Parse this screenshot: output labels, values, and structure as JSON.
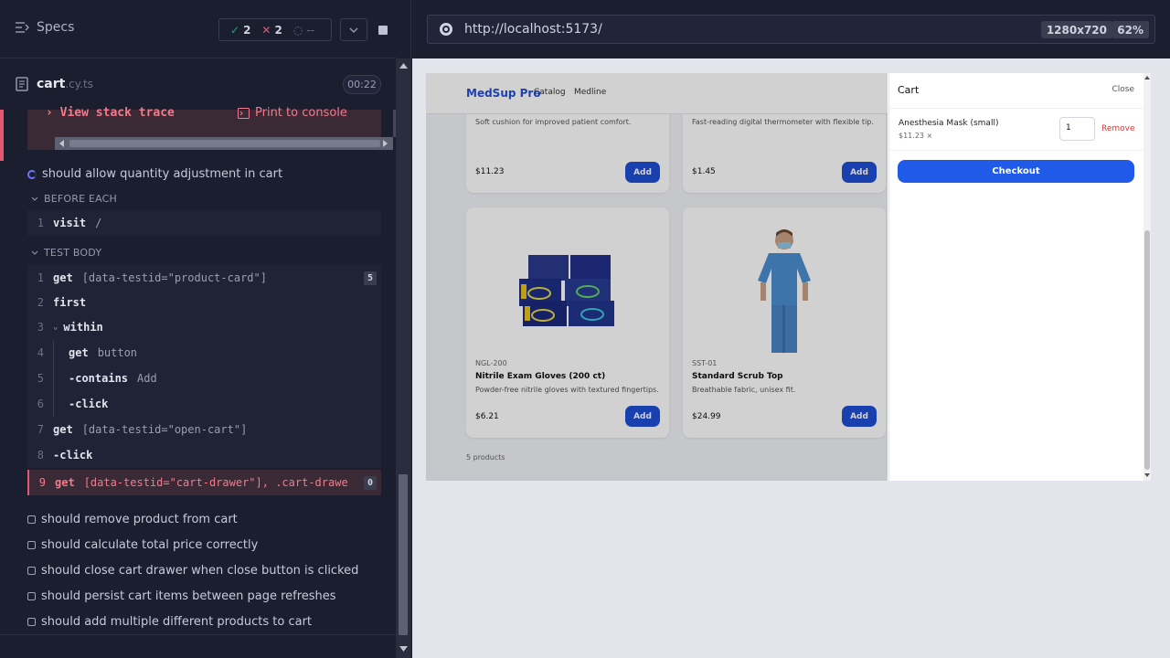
{
  "runner": {
    "specs_label": "Specs",
    "passed": "2",
    "failed": "2",
    "pending": "--",
    "file_name": "cart",
    "file_ext": ".cy.ts",
    "timer": "00:22",
    "stack_trace": "View stack trace",
    "print_console": "Print to console",
    "running_test": "should allow quantity adjustment in cart",
    "before_each": "BEFORE EACH",
    "test_body": "TEST BODY",
    "before_cmds": [
      {
        "num": "1",
        "name": "visit",
        "arg": "/"
      }
    ],
    "commands": [
      {
        "num": "1",
        "name": "get",
        "arg": "[data-testid=\"product-card\"]",
        "badge": "5"
      },
      {
        "num": "2",
        "name": "first",
        "arg": ""
      },
      {
        "num": "3",
        "name": "within",
        "arg": ""
      },
      {
        "num": "4",
        "name": "get",
        "arg": "button"
      },
      {
        "num": "5",
        "name": "-contains",
        "arg": "Add"
      },
      {
        "num": "6",
        "name": "-click",
        "arg": ""
      },
      {
        "num": "7",
        "name": "get",
        "arg": "[data-testid=\"open-cart\"]"
      },
      {
        "num": "8",
        "name": "-click",
        "arg": ""
      },
      {
        "num": "9",
        "name": "get",
        "arg": "[data-testid=\"cart-drawer\"], .cart-drawer",
        "badge": "0"
      }
    ],
    "remaining_tests": [
      "should remove product from cart",
      "should calculate total price correctly",
      "should close cart drawer when close button is clicked",
      "should persist cart items between page refreshes",
      "should add multiple different products to cart"
    ]
  },
  "browser": {
    "url": "http://localhost:5173/",
    "viewport": "1280x720",
    "zoom": "62%"
  },
  "shop": {
    "brand": "MedSup Pro",
    "nav": [
      "Catalog",
      "Medline"
    ],
    "top_cards": [
      {
        "desc": "Soft cushion for improved patient comfort.",
        "price": "$11.23",
        "add": "Add"
      },
      {
        "desc": "Fast-reading digital thermometer with flexible tip.",
        "price": "$1.45",
        "add": "Add"
      }
    ],
    "cards": [
      {
        "sku": "NGL-200",
        "title": "Nitrile Exam Gloves (200 ct)",
        "desc": "Powder-free nitrile gloves with textured fingertips.",
        "price": "$6.21",
        "add": "Add"
      },
      {
        "sku": "SST-01",
        "title": "Standard Scrub Top",
        "desc": "Breathable fabric, unisex fit.",
        "price": "$24.99",
        "add": "Add"
      }
    ],
    "count": "5 products"
  },
  "cart": {
    "title": "Cart",
    "close": "Close",
    "item_name": "Anesthesia Mask (small)",
    "item_price": "$11.23 ×",
    "qty": "1",
    "remove": "Remove",
    "checkout": "Checkout"
  },
  "colors": {
    "accent": "#1f4fd6",
    "fail": "#e45770",
    "pass": "#1fa971"
  }
}
